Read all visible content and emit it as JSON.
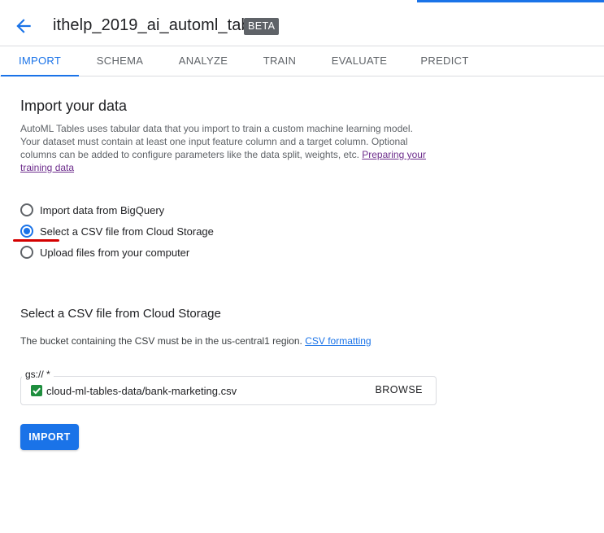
{
  "header": {
    "title": "ithelp_2019_ai_automl_table",
    "badge": "BETA",
    "back_icon": "arrow-back-icon"
  },
  "tabs": [
    {
      "label": "IMPORT",
      "active": true
    },
    {
      "label": "SCHEMA",
      "active": false
    },
    {
      "label": "ANALYZE",
      "active": false
    },
    {
      "label": "TRAIN",
      "active": false
    },
    {
      "label": "EVALUATE",
      "active": false
    },
    {
      "label": "PREDICT",
      "active": false
    }
  ],
  "import_section": {
    "heading": "Import your data",
    "description": "AutoML Tables uses tabular data that you import to train a custom machine learning model. Your dataset must contain at least one input feature column and a target column. Optional columns can be added to configure parameters like the data split, weights, etc.",
    "link": "Preparing your training data"
  },
  "source_options": [
    {
      "label": "Import data from BigQuery",
      "selected": false
    },
    {
      "label": "Select a CSV file from Cloud Storage",
      "selected": true
    },
    {
      "label": "Upload files from your computer",
      "selected": false
    }
  ],
  "csv_section": {
    "heading": "Select a CSV file from Cloud Storage",
    "note": "The bucket containing the CSV must be in the us-central1 region.",
    "note_link": "CSV formatting",
    "field_label": "gs:// *",
    "field_value": "cloud-ml-tables-data/bank-marketing.csv",
    "browse_label": "BROWSE",
    "check_icon": "checkbox-checked-icon"
  },
  "import_button": "IMPORT",
  "colors": {
    "accent": "#1a73e8",
    "beta_badge": "#5f6368",
    "valid_check": "#1e8e3e",
    "annotation_red": "#d40000",
    "visited_link": "#6d2d8c"
  }
}
